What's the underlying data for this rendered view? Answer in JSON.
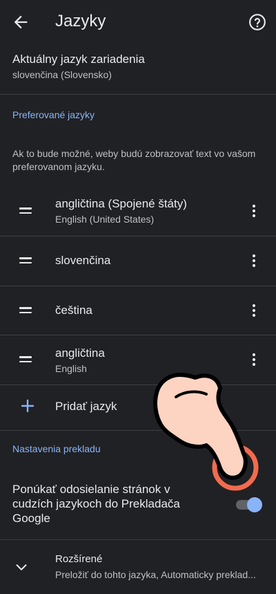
{
  "appbar": {
    "title": "Jazyky",
    "back_icon": "arrow-back-icon",
    "help_icon": "help-circle-icon"
  },
  "device_language": {
    "label": "Aktuálny jazyk zariadenia",
    "value": "slovenčina (Slovensko)"
  },
  "preferred": {
    "section_title": "Preferované jazyky",
    "description": "Ak to bude možné, weby budú zobrazovať text vo vašom preferovanom jazyku.",
    "languages": [
      {
        "name": "angličtina (Spojené štáty)",
        "native": "English (United States)"
      },
      {
        "name": "slovenčina",
        "native": ""
      },
      {
        "name": "čeština",
        "native": ""
      },
      {
        "name": "angličtina",
        "native": "English"
      }
    ],
    "add_label": "Pridať jazyk"
  },
  "translation": {
    "section_title": "Nastavenia prekladu",
    "offer_label": "Ponúkať odosielanie stránok v cudzích jazykoch do Prekladača Google",
    "offer_enabled": true
  },
  "advanced": {
    "title": "Rozšírené",
    "summary": "Preložiť do tohto jazyka, Automaticky preklad..."
  },
  "colors": {
    "background": "#202124",
    "accent": "#8ab4f8",
    "divider": "#3c4043",
    "hand_fill": "#fdd3c2",
    "tap_ring": "#f26b4f"
  }
}
